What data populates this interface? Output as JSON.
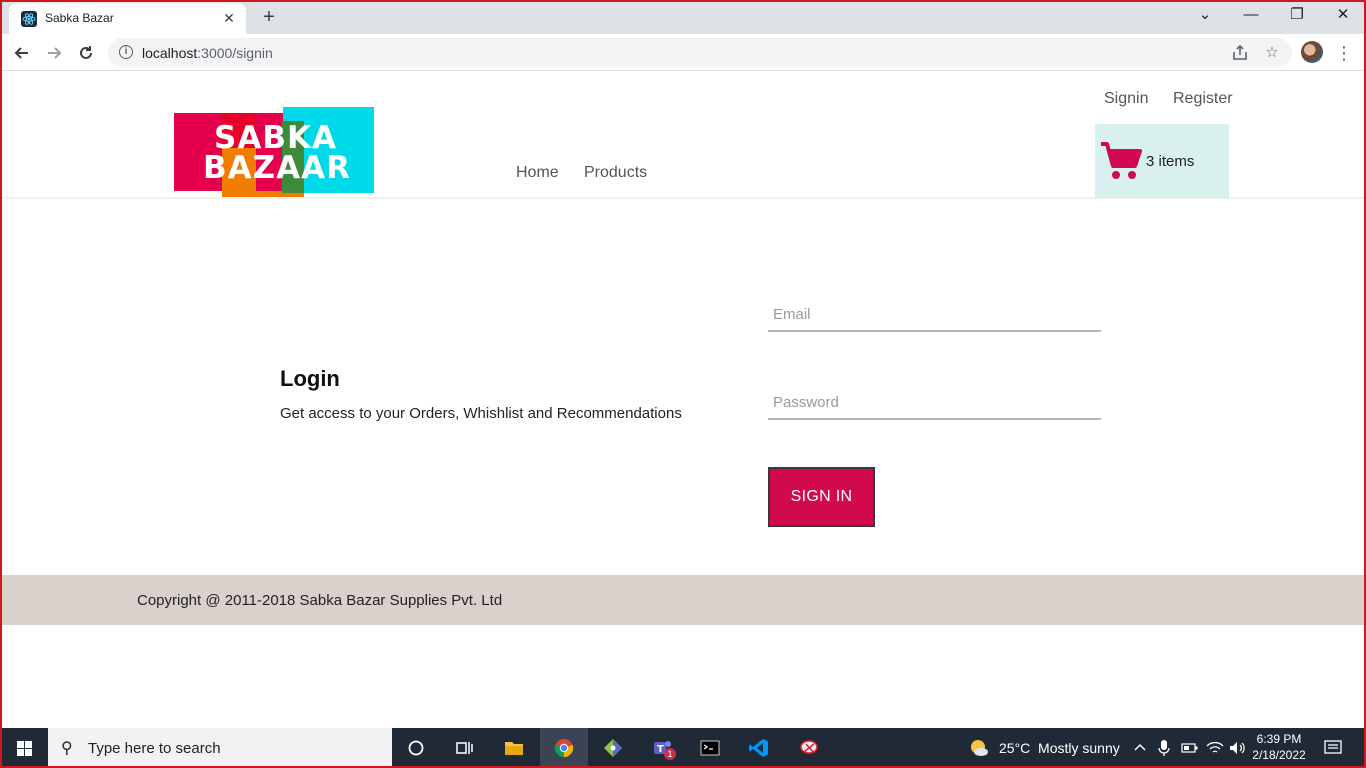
{
  "browser": {
    "tab_title": "Sabka Bazar",
    "tab_close": "✕",
    "new_tab": "+",
    "url_host": "localhost",
    "url_path": ":3000/signin",
    "window_controls": {
      "minimize": "—",
      "restore": "❐",
      "close": "✕",
      "tab_search": "⌄"
    }
  },
  "header": {
    "logo": {
      "line1": "SABKA",
      "line2": "BAZAAR"
    },
    "signin_label": "Signin",
    "register_label": "Register",
    "nav": [
      {
        "label": "Home"
      },
      {
        "label": "Products"
      }
    ],
    "cart_label": "3 items"
  },
  "login": {
    "title": "Login",
    "subtitle": "Get access to your Orders, Whishlist and Recommendations",
    "email_placeholder": "Email",
    "password_placeholder": "Password",
    "button_label": "SIGN IN"
  },
  "footer": {
    "text": "Copyright @ 2011-2018 Sabka Bazar Supplies Pvt. Ltd"
  },
  "taskbar": {
    "search_placeholder": "Type here to search",
    "weather": "25°C  Mostly sunny",
    "time": "6:39 PM",
    "date": "2/18/2022",
    "teams_badge": "1"
  },
  "colors": {
    "accent": "#d1094e",
    "cart_bg": "#d9f1ee",
    "footer_bg": "#dad0cc"
  }
}
